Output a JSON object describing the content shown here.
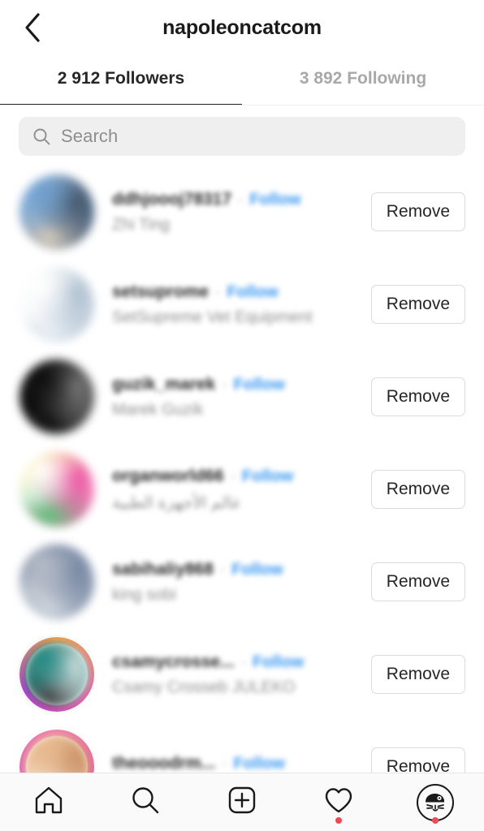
{
  "header": {
    "title": "napoleoncatcom",
    "back_icon": "chevron-left-icon"
  },
  "tabs": [
    {
      "label": "2 912 Followers",
      "active": true
    },
    {
      "label": "3 892 Following",
      "active": false
    }
  ],
  "search": {
    "placeholder": "Search",
    "value": "",
    "icon": "search-icon"
  },
  "list": {
    "follow_label": "Follow",
    "separator": "·",
    "remove_label": "Remove",
    "rows": [
      {
        "username": "ddhjoooj78317",
        "fullname": "Zhi Ting",
        "follow": "Follow",
        "remove": "Remove",
        "avatar_colors": [
          "#6f9fd0",
          "#cfe3f2",
          "#3f4a58",
          "#d8cdbe"
        ],
        "has_story_ring": false
      },
      {
        "username": "setsuprome",
        "fullname": "SetSupreme Vet Equipment",
        "follow": "Follow",
        "remove": "Remove",
        "avatar_colors": [
          "#ffffff",
          "#f4f4f4",
          "#9fb3c8",
          "#e8eef4"
        ],
        "has_story_ring": false
      },
      {
        "username": "guzik_marek",
        "fullname": "Marek Guzik",
        "follow": "Follow",
        "remove": "Remove",
        "avatar_colors": [
          "#0d0d0d",
          "#2c2c2c",
          "#8a8a8a",
          "#111111"
        ],
        "has_story_ring": false
      },
      {
        "username": "organworld66",
        "fullname": "عالم الأجهزة الطبية",
        "follow": "Follow",
        "remove": "Remove",
        "avatar_colors": [
          "#ffffff",
          "#f2d23a",
          "#e8338f",
          "#5fc07a"
        ],
        "has_story_ring": false
      },
      {
        "username": "sabihaliy868",
        "fullname": "king sobi",
        "follow": "Follow",
        "remove": "Remove",
        "avatar_colors": [
          "#b8bec8",
          "#2c4a82",
          "#6d7f9e",
          "#cfd6de"
        ],
        "has_story_ring": false
      },
      {
        "username": "csamycrosse...",
        "fullname": "Csamy Crosseb JULEKO",
        "follow": "Follow",
        "remove": "Remove",
        "avatar_colors": [
          "#1f8a86",
          "#c9a37a",
          "#e8e8e8",
          "#4a4a4a"
        ],
        "has_story_ring": true,
        "ring_colors": [
          "#f9a03f",
          "#e95f9e",
          "#c13adc"
        ]
      },
      {
        "username": "theooodrm...",
        "fullname": "",
        "follow": "Follow",
        "remove": "Remove",
        "avatar_colors": [
          "#e8b98e",
          "#f2d4b6",
          "#c98f64",
          "#ffffff"
        ],
        "has_story_ring": true,
        "ring_colors": [
          "#f07ab0",
          "#e95f9e",
          "#d95ab8"
        ]
      }
    ]
  },
  "bottom_nav": [
    {
      "name": "home-icon",
      "badge": false
    },
    {
      "name": "search-icon",
      "badge": false
    },
    {
      "name": "add-post-icon",
      "badge": false
    },
    {
      "name": "heart-icon",
      "badge": true
    },
    {
      "name": "profile-avatar-icon",
      "badge": true
    }
  ],
  "colors": {
    "accent_blue": "#3897f0",
    "badge_red": "#ed4956",
    "text_primary": "#262626",
    "text_secondary": "#8e8e8e",
    "field_bg": "#efefef",
    "border": "#dbdbdb"
  }
}
